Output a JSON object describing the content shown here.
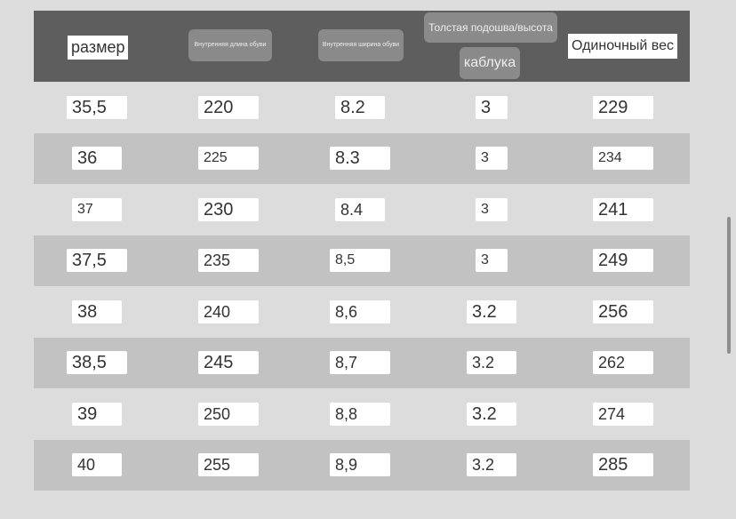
{
  "header": {
    "size": "размер",
    "inner_length": "Внутренняя длина обуви",
    "inner_width": "Внутренняя ширина обуви",
    "sole_line1": "Толстая подошва/высота",
    "sole_line2": "каблука",
    "weight": "Одиночный вес"
  },
  "rows": [
    [
      "35,5",
      "220",
      "8.2",
      "3",
      "229"
    ],
    [
      "36",
      "225",
      "8.3",
      "3",
      "234"
    ],
    [
      "37",
      "230",
      "8.4",
      "3",
      "241"
    ],
    [
      "37,5",
      "235",
      "8,5",
      "3",
      "249"
    ],
    [
      "38",
      "240",
      "8,6",
      "3.2",
      "256"
    ],
    [
      "38,5",
      "245",
      "8,7",
      "3.2",
      "262"
    ],
    [
      "39",
      "250",
      "8,8",
      "3.2",
      "274"
    ],
    [
      "40",
      "255",
      "8,9",
      "3.2",
      "285"
    ]
  ],
  "colors": {
    "header_bg": "#5e5e5e",
    "row_light": "#dcdcdc",
    "row_dark": "#c2c2c2"
  }
}
